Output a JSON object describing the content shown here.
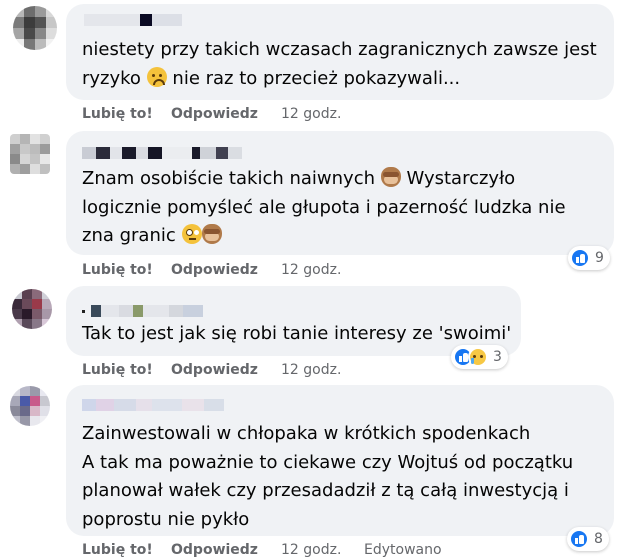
{
  "comments": [
    {
      "text_lines": [
        "niestety przy takich wczasach zagranicznych zawsze jest",
        "ryzyko",
        "nie raz to przecież pokazywali..."
      ],
      "emojis": [
        "frowning-face"
      ],
      "actions": {
        "like": "Lubię to!",
        "reply": "Odpowiedz",
        "time": "12 godz."
      }
    },
    {
      "text_lines": [
        "Znam osobiście takich naiwnych",
        "Wystarczyło",
        "logicznie pomyśleć ale głupota i pazerność ludzka nie",
        "zna granic"
      ],
      "emojis": [
        "see-no-evil-monkey",
        "face-with-rolling-eyes",
        "see-no-evil-monkey"
      ],
      "reactions": {
        "types": [
          "like"
        ],
        "count": "9"
      },
      "actions": {
        "like": "Lubię to!",
        "reply": "Odpowiedz",
        "time": "12 godz."
      }
    },
    {
      "text_lines": [
        "Tak to jest jak się robi tanie interesy ze 'swoimi'"
      ],
      "reactions": {
        "types": [
          "like",
          "sad"
        ],
        "count": "3"
      },
      "actions": {
        "like": "Lubię to!",
        "reply": "Odpowiedz",
        "time": "12 godz."
      }
    },
    {
      "text_lines": [
        "Zainwestowali w chłopaka w krótkich spodenkach",
        "A tak ma poważnie to ciekawe czy Wojtuś od początku",
        "planował wałek czy przesadadził z tą całą inwestycją i",
        "poprostu nie pykło"
      ],
      "reactions": {
        "types": [
          "like"
        ],
        "count": "8"
      },
      "actions": {
        "like": "Lubię to!",
        "reply": "Odpowiedz",
        "time": "12 godz.",
        "edited": "Edytowano"
      }
    }
  ],
  "colors": {
    "bubble": "#f0f2f5",
    "text": "#050505",
    "meta": "#65676b",
    "like_blue": "#1877f2"
  }
}
